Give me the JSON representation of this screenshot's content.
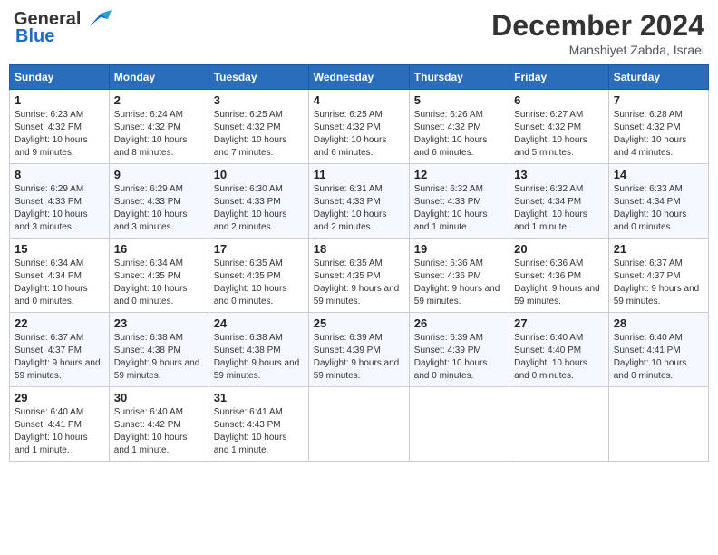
{
  "header": {
    "logo_line1": "General",
    "logo_line2": "Blue",
    "month": "December 2024",
    "location": "Manshiyet Zabda, Israel"
  },
  "days_of_week": [
    "Sunday",
    "Monday",
    "Tuesday",
    "Wednesday",
    "Thursday",
    "Friday",
    "Saturday"
  ],
  "weeks": [
    [
      {
        "day": "1",
        "sunrise": "6:23 AM",
        "sunset": "4:32 PM",
        "daylight": "10 hours and 9 minutes."
      },
      {
        "day": "2",
        "sunrise": "6:24 AM",
        "sunset": "4:32 PM",
        "daylight": "10 hours and 8 minutes."
      },
      {
        "day": "3",
        "sunrise": "6:25 AM",
        "sunset": "4:32 PM",
        "daylight": "10 hours and 7 minutes."
      },
      {
        "day": "4",
        "sunrise": "6:25 AM",
        "sunset": "4:32 PM",
        "daylight": "10 hours and 6 minutes."
      },
      {
        "day": "5",
        "sunrise": "6:26 AM",
        "sunset": "4:32 PM",
        "daylight": "10 hours and 6 minutes."
      },
      {
        "day": "6",
        "sunrise": "6:27 AM",
        "sunset": "4:32 PM",
        "daylight": "10 hours and 5 minutes."
      },
      {
        "day": "7",
        "sunrise": "6:28 AM",
        "sunset": "4:32 PM",
        "daylight": "10 hours and 4 minutes."
      }
    ],
    [
      {
        "day": "8",
        "sunrise": "6:29 AM",
        "sunset": "4:33 PM",
        "daylight": "10 hours and 3 minutes."
      },
      {
        "day": "9",
        "sunrise": "6:29 AM",
        "sunset": "4:33 PM",
        "daylight": "10 hours and 3 minutes."
      },
      {
        "day": "10",
        "sunrise": "6:30 AM",
        "sunset": "4:33 PM",
        "daylight": "10 hours and 2 minutes."
      },
      {
        "day": "11",
        "sunrise": "6:31 AM",
        "sunset": "4:33 PM",
        "daylight": "10 hours and 2 minutes."
      },
      {
        "day": "12",
        "sunrise": "6:32 AM",
        "sunset": "4:33 PM",
        "daylight": "10 hours and 1 minute."
      },
      {
        "day": "13",
        "sunrise": "6:32 AM",
        "sunset": "4:34 PM",
        "daylight": "10 hours and 1 minute."
      },
      {
        "day": "14",
        "sunrise": "6:33 AM",
        "sunset": "4:34 PM",
        "daylight": "10 hours and 0 minutes."
      }
    ],
    [
      {
        "day": "15",
        "sunrise": "6:34 AM",
        "sunset": "4:34 PM",
        "daylight": "10 hours and 0 minutes."
      },
      {
        "day": "16",
        "sunrise": "6:34 AM",
        "sunset": "4:35 PM",
        "daylight": "10 hours and 0 minutes."
      },
      {
        "day": "17",
        "sunrise": "6:35 AM",
        "sunset": "4:35 PM",
        "daylight": "10 hours and 0 minutes."
      },
      {
        "day": "18",
        "sunrise": "6:35 AM",
        "sunset": "4:35 PM",
        "daylight": "9 hours and 59 minutes."
      },
      {
        "day": "19",
        "sunrise": "6:36 AM",
        "sunset": "4:36 PM",
        "daylight": "9 hours and 59 minutes."
      },
      {
        "day": "20",
        "sunrise": "6:36 AM",
        "sunset": "4:36 PM",
        "daylight": "9 hours and 59 minutes."
      },
      {
        "day": "21",
        "sunrise": "6:37 AM",
        "sunset": "4:37 PM",
        "daylight": "9 hours and 59 minutes."
      }
    ],
    [
      {
        "day": "22",
        "sunrise": "6:37 AM",
        "sunset": "4:37 PM",
        "daylight": "9 hours and 59 minutes."
      },
      {
        "day": "23",
        "sunrise": "6:38 AM",
        "sunset": "4:38 PM",
        "daylight": "9 hours and 59 minutes."
      },
      {
        "day": "24",
        "sunrise": "6:38 AM",
        "sunset": "4:38 PM",
        "daylight": "9 hours and 59 minutes."
      },
      {
        "day": "25",
        "sunrise": "6:39 AM",
        "sunset": "4:39 PM",
        "daylight": "9 hours and 59 minutes."
      },
      {
        "day": "26",
        "sunrise": "6:39 AM",
        "sunset": "4:39 PM",
        "daylight": "10 hours and 0 minutes."
      },
      {
        "day": "27",
        "sunrise": "6:40 AM",
        "sunset": "4:40 PM",
        "daylight": "10 hours and 0 minutes."
      },
      {
        "day": "28",
        "sunrise": "6:40 AM",
        "sunset": "4:41 PM",
        "daylight": "10 hours and 0 minutes."
      }
    ],
    [
      {
        "day": "29",
        "sunrise": "6:40 AM",
        "sunset": "4:41 PM",
        "daylight": "10 hours and 1 minute."
      },
      {
        "day": "30",
        "sunrise": "6:40 AM",
        "sunset": "4:42 PM",
        "daylight": "10 hours and 1 minute."
      },
      {
        "day": "31",
        "sunrise": "6:41 AM",
        "sunset": "4:43 PM",
        "daylight": "10 hours and 1 minute."
      },
      null,
      null,
      null,
      null
    ]
  ]
}
